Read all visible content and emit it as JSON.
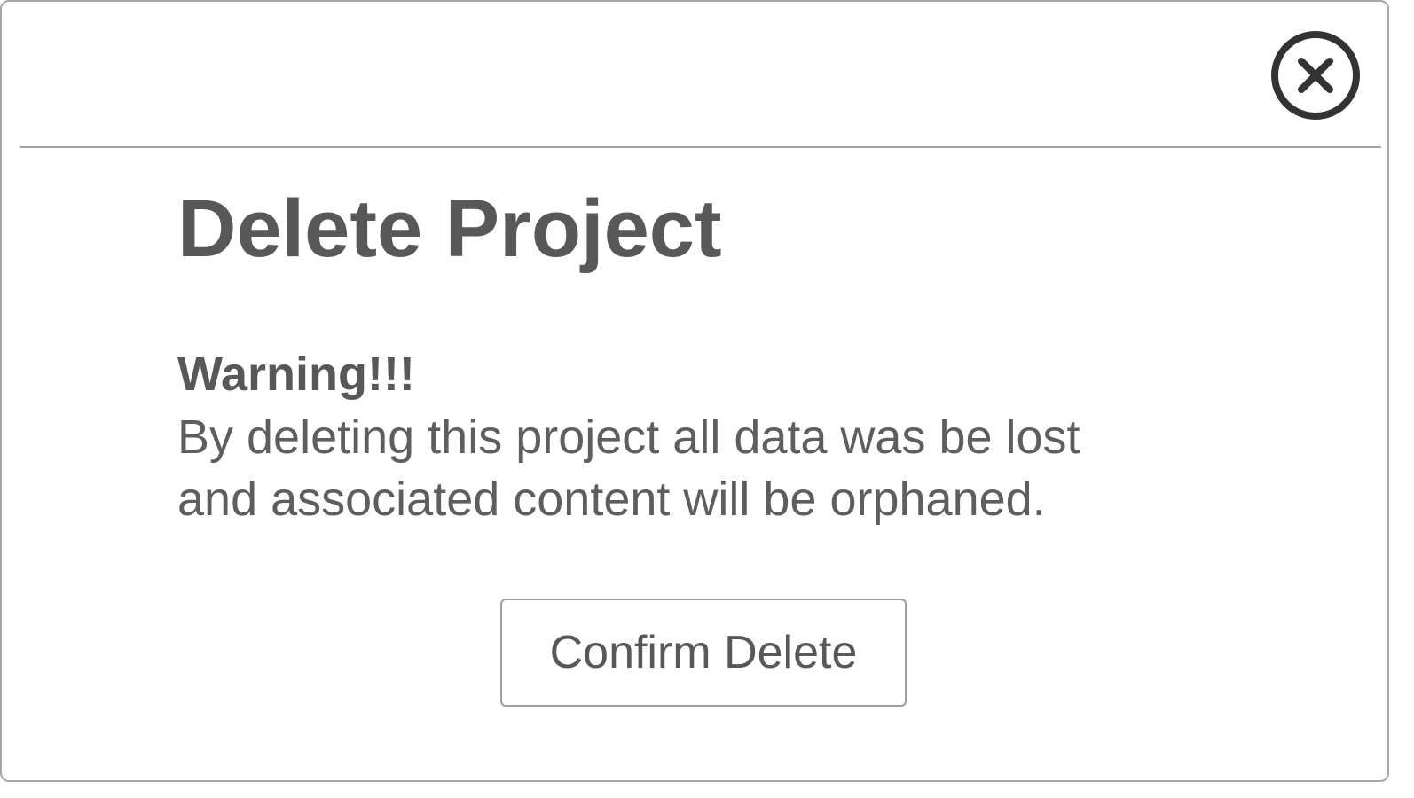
{
  "dialog": {
    "title": "Delete Project",
    "close_icon": "close-circle-icon",
    "warning": {
      "heading": "Warning!!!",
      "lines": [
        "By deleting this project all data was be lost",
        "and associated content will be orphaned."
      ]
    },
    "confirm_label": "Confirm Delete"
  },
  "colors": {
    "text": "#585858",
    "border": "#a6a6a6",
    "icon": "#333333",
    "background": "#ffffff"
  }
}
